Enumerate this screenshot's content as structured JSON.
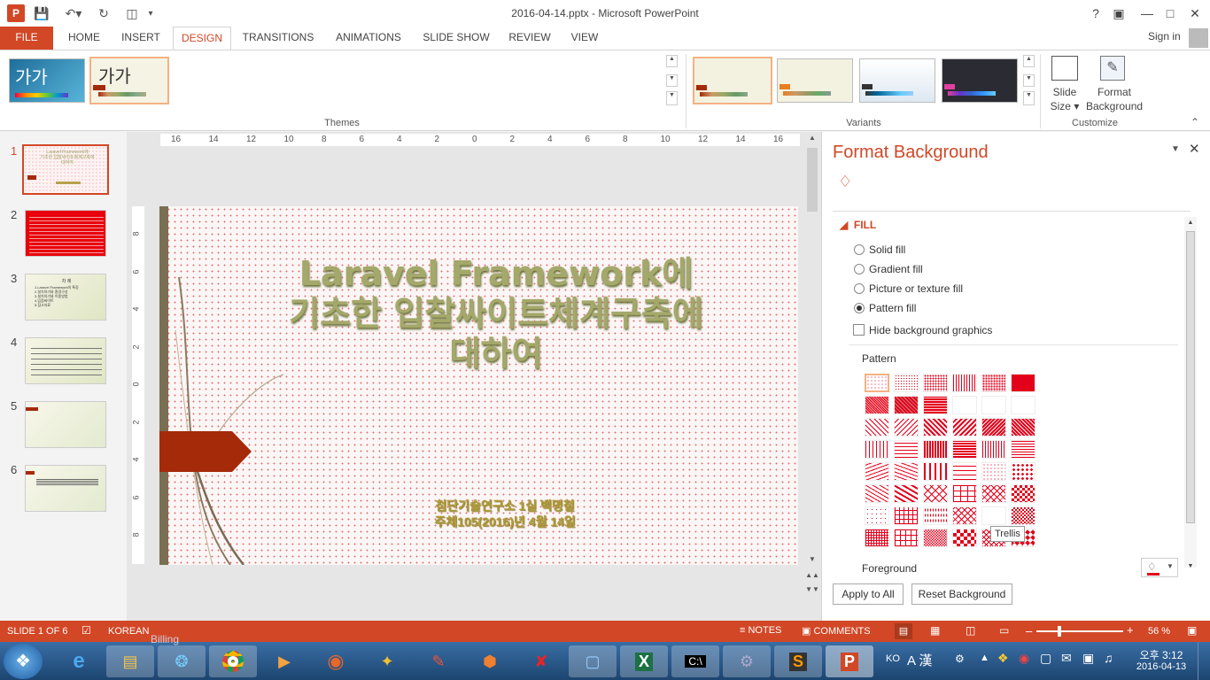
{
  "window": {
    "title": "2016-04-14.pptx - Microsoft PowerPoint",
    "signin": "Sign in"
  },
  "tabs": [
    "FILE",
    "HOME",
    "INSERT",
    "DESIGN",
    "TRANSITIONS",
    "ANIMATIONS",
    "SLIDE SHOW",
    "REVIEW",
    "VIEW"
  ],
  "active_tab": "DESIGN",
  "ribbon": {
    "themes_label": "Themes",
    "theme_sample": "가가",
    "variants_label": "Variants",
    "customize_label": "Customize",
    "slide_size_line1": "Slide",
    "slide_size_line2": "Size",
    "format_bg_line1": "Format",
    "format_bg_line2": "Background"
  },
  "slides": [
    {
      "num": "1"
    },
    {
      "num": "2"
    },
    {
      "num": "3"
    },
    {
      "num": "4"
    },
    {
      "num": "5"
    },
    {
      "num": "6"
    }
  ],
  "thumb3": {
    "title": "차 례",
    "l1": "1.Laravel Framework의 특징",
    "l2": "2.설치하기와 환경구성",
    "l3": "3.설치하기와 이용방법",
    "l4": "4.입점싸이트",
    "l5": "5.참고자료"
  },
  "ruler": {
    "h_ticks": [
      "16",
      "14",
      "12",
      "10",
      "8",
      "6",
      "4",
      "2",
      "0",
      "2",
      "4",
      "6",
      "8",
      "10",
      "12",
      "14",
      "16"
    ],
    "v_ticks": [
      "8",
      "6",
      "4",
      "2",
      "0",
      "2",
      "4",
      "6",
      "8"
    ]
  },
  "slide": {
    "title_line1": "Laravel Framework에",
    "title_line2": "기초한  입찰싸이트체계구축에",
    "title_line3": "대하여",
    "sub_line1": "첨단기술연구소 1실 백명철",
    "sub_line2": "주체105(2016)년 4월 14일"
  },
  "pane": {
    "title": "Format Background",
    "fill_heading": "FILL",
    "options": [
      "Solid fill",
      "Gradient fill",
      "Picture or texture fill",
      "Pattern fill"
    ],
    "selected_option": "Pattern fill",
    "hide_bg": "Hide background graphics",
    "pattern_label": "Pattern",
    "tooltip": "Trellis",
    "foreground_label": "Foreground",
    "apply_all": "Apply to All",
    "reset": "Reset Background",
    "accent": "#e3001b"
  },
  "status": {
    "slide": "SLIDE 1 OF 6",
    "lang": "KOREAN",
    "notes": "NOTES",
    "comments": "COMMENTS",
    "zoom": "56 %"
  },
  "taskbar": {
    "ime": "KO",
    "ime_a": "A",
    "ime_han": "漢",
    "time": "오후 3:12",
    "date": "2016-04-13",
    "ghost": "Billing"
  }
}
